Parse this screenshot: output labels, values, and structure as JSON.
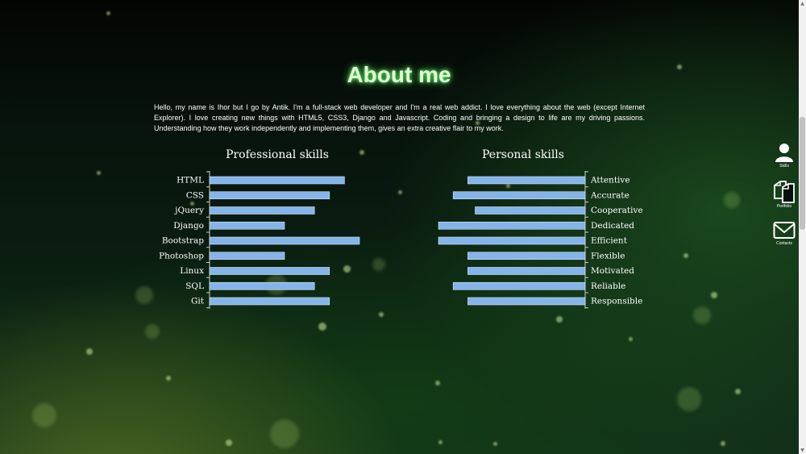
{
  "about": {
    "title": "About me",
    "intro": "Hello, my name is Ihor but I go by Antik. I'm a full-stack web developer and I'm a real web addict. I love everything about the web (except Internet Explorer). I love creating new things with HTML5, CSS3, Django and Javascript. Coding and bringing a design to life are my driving passions. Understanding how they work independently and implementing them, gives an extra creative flair to my work."
  },
  "chart_data": [
    {
      "type": "bar",
      "title": "Professional skills",
      "orientation": "horizontal",
      "direction": "left-to-right",
      "categories": [
        "HTML",
        "CSS",
        "jQuery",
        "Django",
        "Bootstrap",
        "Photoshop",
        "Linux",
        "SQL",
        "Git"
      ],
      "values": [
        90,
        80,
        70,
        50,
        100,
        50,
        80,
        70,
        80
      ],
      "xlim": [
        0,
        100
      ]
    },
    {
      "type": "bar",
      "title": "Personal skills",
      "orientation": "horizontal",
      "direction": "right-to-left",
      "categories": [
        "Attentive",
        "Accurate",
        "Cooperative",
        "Dedicated",
        "Efficient",
        "Flexible",
        "Motivated",
        "Reliable",
        "Responsible"
      ],
      "values": [
        80,
        90,
        75,
        100,
        100,
        80,
        80,
        90,
        80
      ],
      "xlim": [
        0,
        100
      ]
    }
  ],
  "colors": {
    "bar": "#84b4e8",
    "title_glow": "#5fe25a"
  },
  "nav": {
    "items": [
      {
        "label": "Skills",
        "icon": "user-icon"
      },
      {
        "label": "Portfolio",
        "icon": "documents-icon"
      },
      {
        "label": "Contacts",
        "icon": "envelope-icon"
      }
    ]
  }
}
